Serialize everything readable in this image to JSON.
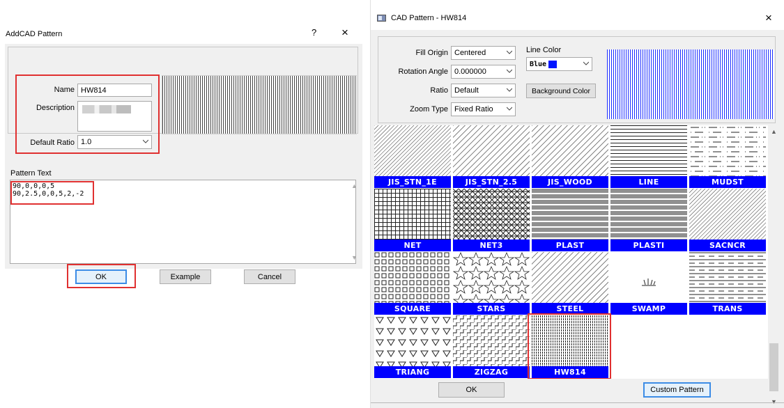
{
  "left_dialog": {
    "title": "AddCAD Pattern",
    "help": "?",
    "close": "×",
    "name_label": "Name",
    "name_value": "HW814",
    "description_label": "Description",
    "default_ratio_label": "Default Ratio",
    "default_ratio_value": "1.0",
    "pattern_text_label": "Pattern Text",
    "pattern_text_line1": "90,0,0,0,5",
    "pattern_text_line2": "90,2.5,0,0,5,2,-2",
    "ok": "OK",
    "example": "Example",
    "cancel": "Cancel"
  },
  "right_dialog": {
    "title": "CAD Pattern - HW814",
    "close": "×",
    "fill_origin_label": "Fill Origin",
    "fill_origin_value": "Centered",
    "rotation_label": "Rotation Angle",
    "rotation_value": "0.000000",
    "ratio_label": "Ratio",
    "ratio_value": "Default",
    "zoom_label": "Zoom Type",
    "zoom_value": "Fixed Ratio",
    "line_color_label": "Line Color",
    "line_color_value": "Blue",
    "background_color": "Background Color",
    "ok": "OK",
    "custom_pattern": "Custom Pattern",
    "patterns": [
      {
        "name": "JIS_STN_1E"
      },
      {
        "name": "JIS_STN_2.5"
      },
      {
        "name": "JIS_WOOD"
      },
      {
        "name": "LINE"
      },
      {
        "name": "MUDST"
      },
      {
        "name": "NET"
      },
      {
        "name": "NET3"
      },
      {
        "name": "PLAST"
      },
      {
        "name": "PLASTI"
      },
      {
        "name": "SACNCR"
      },
      {
        "name": "SQUARE"
      },
      {
        "name": "STARS"
      },
      {
        "name": "STEEL"
      },
      {
        "name": "SWAMP"
      },
      {
        "name": "TRANS"
      },
      {
        "name": "TRIANG"
      },
      {
        "name": "ZIGZAG"
      },
      {
        "name": "HW814"
      }
    ]
  },
  "colors": {
    "highlight": "#e03030",
    "label_bar": "#0000ff",
    "line_color": "#0015ff"
  }
}
